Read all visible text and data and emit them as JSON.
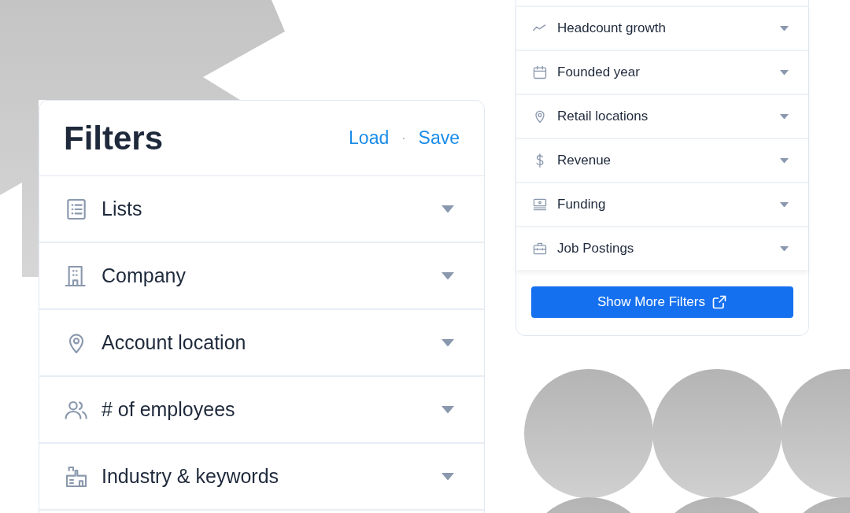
{
  "filters_panel": {
    "title": "Filters",
    "actions": [
      "Load",
      "Save"
    ],
    "separator": "·",
    "items": [
      {
        "label": "Lists",
        "expanded": false
      },
      {
        "label": "Company",
        "expanded": false
      },
      {
        "label": "Account location",
        "expanded": false
      },
      {
        "label": "# of employees",
        "expanded": false
      },
      {
        "label": "Industry & keywords",
        "expanded": false
      }
    ]
  },
  "more_filters_panel": {
    "items": [
      {
        "label": "Headcount growth",
        "expanded": false
      },
      {
        "label": "Founded year",
        "expanded": false
      },
      {
        "label": "Retail locations",
        "expanded": false
      },
      {
        "label": "Revenue",
        "expanded": false
      },
      {
        "label": "Funding",
        "expanded": false
      },
      {
        "label": "Job Postings",
        "expanded": false
      }
    ],
    "button": "Show More Filters"
  }
}
